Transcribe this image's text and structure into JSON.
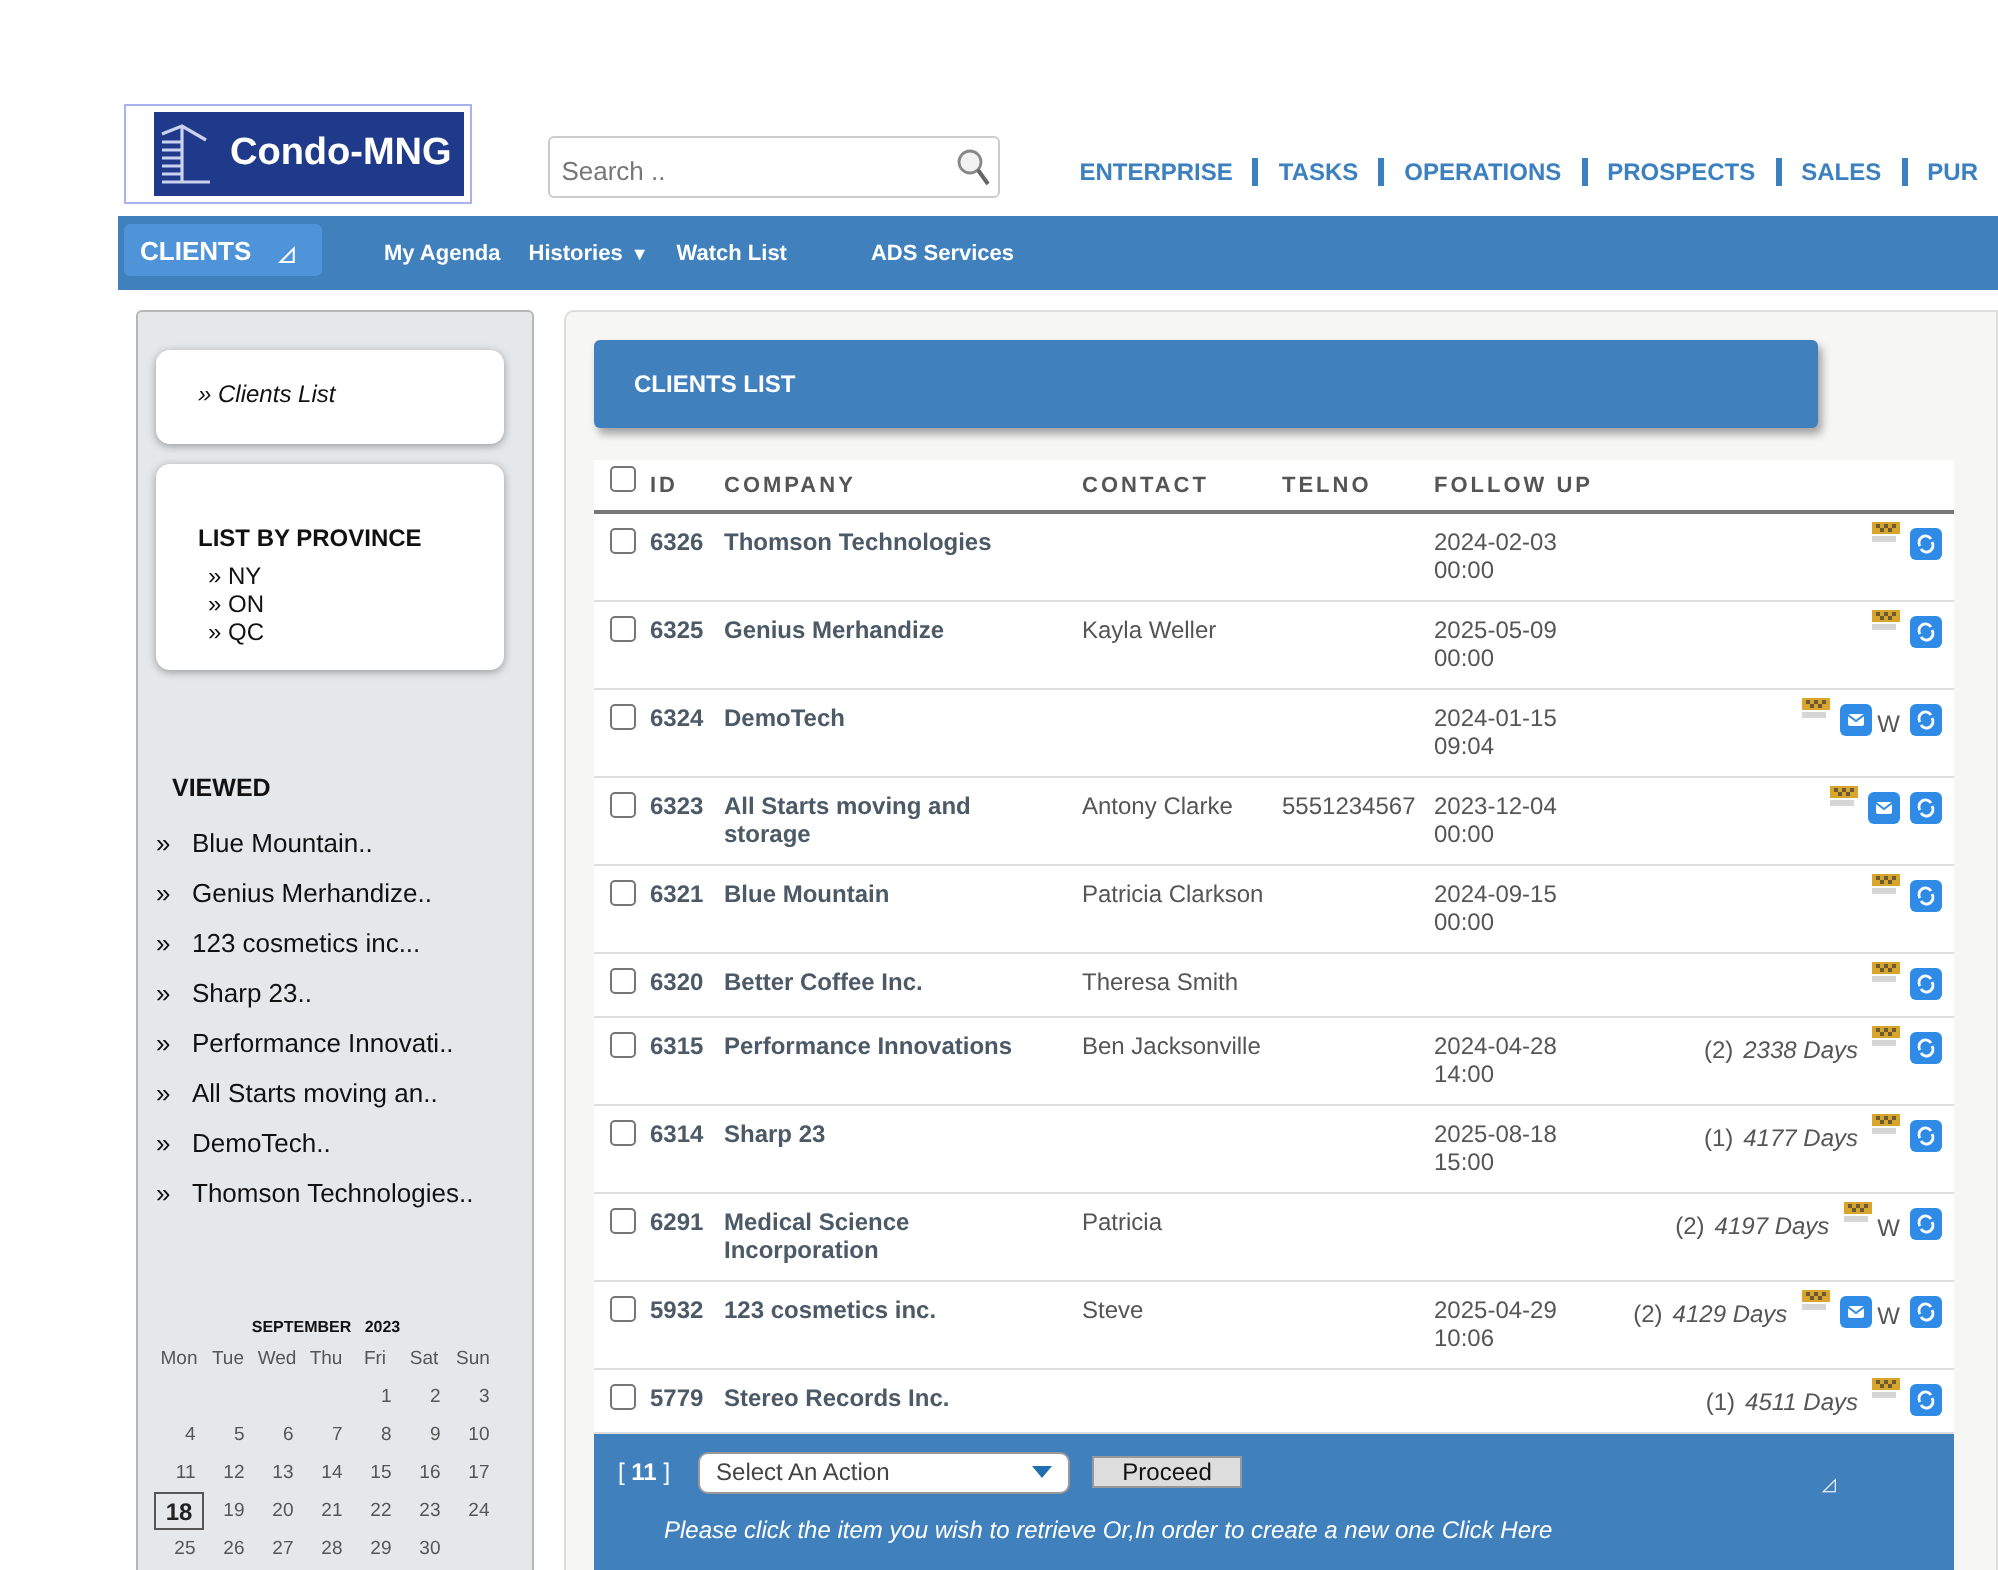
{
  "logo": {
    "text": "Condo-MNG"
  },
  "search": {
    "placeholder": "Search .."
  },
  "top_nav": [
    "ENTERPRISE",
    "TASKS",
    "OPERATIONS",
    "PROSPECTS",
    "SALES",
    "PUR"
  ],
  "menu_bar": {
    "module": "CLIENTS",
    "module_icon": "◿",
    "dropdown_icon": "▼",
    "items": [
      {
        "label": "My Agenda",
        "dropdown": false
      },
      {
        "label": "Histories",
        "dropdown": true
      },
      {
        "label": "Watch List",
        "dropdown": false
      },
      {
        "label": "ADS Services",
        "dropdown": false
      }
    ]
  },
  "sidebar": {
    "links": [
      "» Clients List"
    ],
    "province_title": "LIST BY PROVINCE",
    "provinces": [
      "» NY",
      "» ON",
      "» QC"
    ],
    "viewed_title": "VIEWED",
    "viewed": [
      "Blue Mountain..",
      "Genius Merhandize..",
      "123 cosmetics inc...",
      "Sharp 23..",
      "Performance Innovati..",
      "All Starts moving an..",
      "DemoTech..",
      "Thomson Technologies.."
    ],
    "bullet": "»"
  },
  "calendar": {
    "title": "SEPTEMBER   2023",
    "weekdays": [
      "Mon",
      "Tue",
      "Wed",
      "Thu",
      "Fri",
      "Sat",
      "Sun"
    ],
    "weeks": [
      {
        "kind": "first",
        "days": [
          {
            "d": "1",
            "selected": false
          },
          {
            "d": "2",
            "selected": false
          },
          {
            "d": "3",
            "selected": false
          }
        ]
      },
      {
        "kind": "full",
        "days": [
          {
            "d": "4",
            "selected": false
          },
          {
            "d": "5",
            "selected": false
          },
          {
            "d": "6",
            "selected": false
          },
          {
            "d": "7",
            "selected": false
          },
          {
            "d": "8",
            "selected": false
          },
          {
            "d": "9",
            "selected": false
          },
          {
            "d": "10",
            "selected": false
          }
        ]
      },
      {
        "kind": "full",
        "days": [
          {
            "d": "11",
            "selected": false
          },
          {
            "d": "12",
            "selected": false
          },
          {
            "d": "13",
            "selected": false
          },
          {
            "d": "14",
            "selected": false
          },
          {
            "d": "15",
            "selected": false
          },
          {
            "d": "16",
            "selected": false
          },
          {
            "d": "17",
            "selected": false
          }
        ]
      },
      {
        "kind": "full",
        "days": [
          {
            "d": "18",
            "selected": true
          },
          {
            "d": "19",
            "selected": false
          },
          {
            "d": "20",
            "selected": false
          },
          {
            "d": "21",
            "selected": false
          },
          {
            "d": "22",
            "selected": false
          },
          {
            "d": "23",
            "selected": false
          },
          {
            "d": "24",
            "selected": false
          }
        ]
      },
      {
        "kind": "last",
        "days": [
          {
            "d": "25",
            "selected": false
          },
          {
            "d": "26",
            "selected": false
          },
          {
            "d": "27",
            "selected": false
          },
          {
            "d": "28",
            "selected": false
          },
          {
            "d": "29",
            "selected": false
          },
          {
            "d": "30",
            "selected": false
          }
        ]
      }
    ]
  },
  "panel": {
    "title": "CLIENTS LIST"
  },
  "table": {
    "columns": [
      "ID",
      "COMPANY",
      "CONTACT",
      "TELNO",
      "FOLLOW UP"
    ],
    "header_checked": false,
    "rows": [
      {
        "checked": false,
        "id": "6326",
        "company": "Thomson Technologies",
        "follow_up": [
          "2024-02-03",
          "00:00"
        ],
        "mail": false
      },
      {
        "checked": false,
        "id": "6325",
        "company": "Genius Merhandize",
        "contact": "Kayla Weller",
        "follow_up": [
          "2025-05-09",
          "00:00"
        ],
        "mail": false
      },
      {
        "checked": false,
        "id": "6324",
        "company": "DemoTech",
        "follow_up": [
          "2024-01-15",
          "09:04"
        ],
        "mail": true,
        "w": "W"
      },
      {
        "checked": false,
        "id": "6323",
        "company": "All Starts moving and storage",
        "contact": "Antony Clarke",
        "telno": "5551234567",
        "follow_up": [
          "2023-12-04",
          "00:00"
        ],
        "mail": true
      },
      {
        "checked": false,
        "id": "6321",
        "company": "Blue Mountain",
        "contact": "Patricia Clarkson",
        "follow_up": [
          "2024-09-15",
          "00:00"
        ],
        "mail": false
      },
      {
        "checked": false,
        "id": "6320",
        "company": "Better Coffee Inc.",
        "contact": "Theresa Smith",
        "mail": false
      },
      {
        "checked": false,
        "id": "6315",
        "company": "Performance Innovations",
        "contact": "Ben Jacksonville",
        "follow_up": [
          "2024-04-28",
          "14:00"
        ],
        "count": "(2)",
        "days": "2338 Days",
        "mail": false
      },
      {
        "checked": false,
        "id": "6314",
        "company": "Sharp 23",
        "follow_up": [
          "2025-08-18",
          "15:00"
        ],
        "count": "(1)",
        "days": "4177 Days",
        "mail": false
      },
      {
        "checked": false,
        "id": "6291",
        "company": "Medical Science Incorporation",
        "contact": "Patricia",
        "count": "(2)",
        "days": "4197 Days",
        "mail": false,
        "w": "W"
      },
      {
        "checked": false,
        "id": "5932",
        "company": "123 cosmetics inc.",
        "contact": "Steve",
        "follow_up": [
          "2025-04-29",
          "10:06"
        ],
        "count": "(2)",
        "days": "4129 Days",
        "mail": true,
        "w": "W"
      },
      {
        "checked": false,
        "id": "5779",
        "company": "Stereo Records Inc.",
        "count": "(1)",
        "days": "4511 Days",
        "mail": false
      }
    ]
  },
  "footer": {
    "count": "[ **11** ]",
    "action_placeholder": "Select An Action",
    "proceed": "Proceed",
    "corner_icon": "◿",
    "hint": "Please click the item you wish to retrieve Or,In order to create a new one Click Here"
  }
}
